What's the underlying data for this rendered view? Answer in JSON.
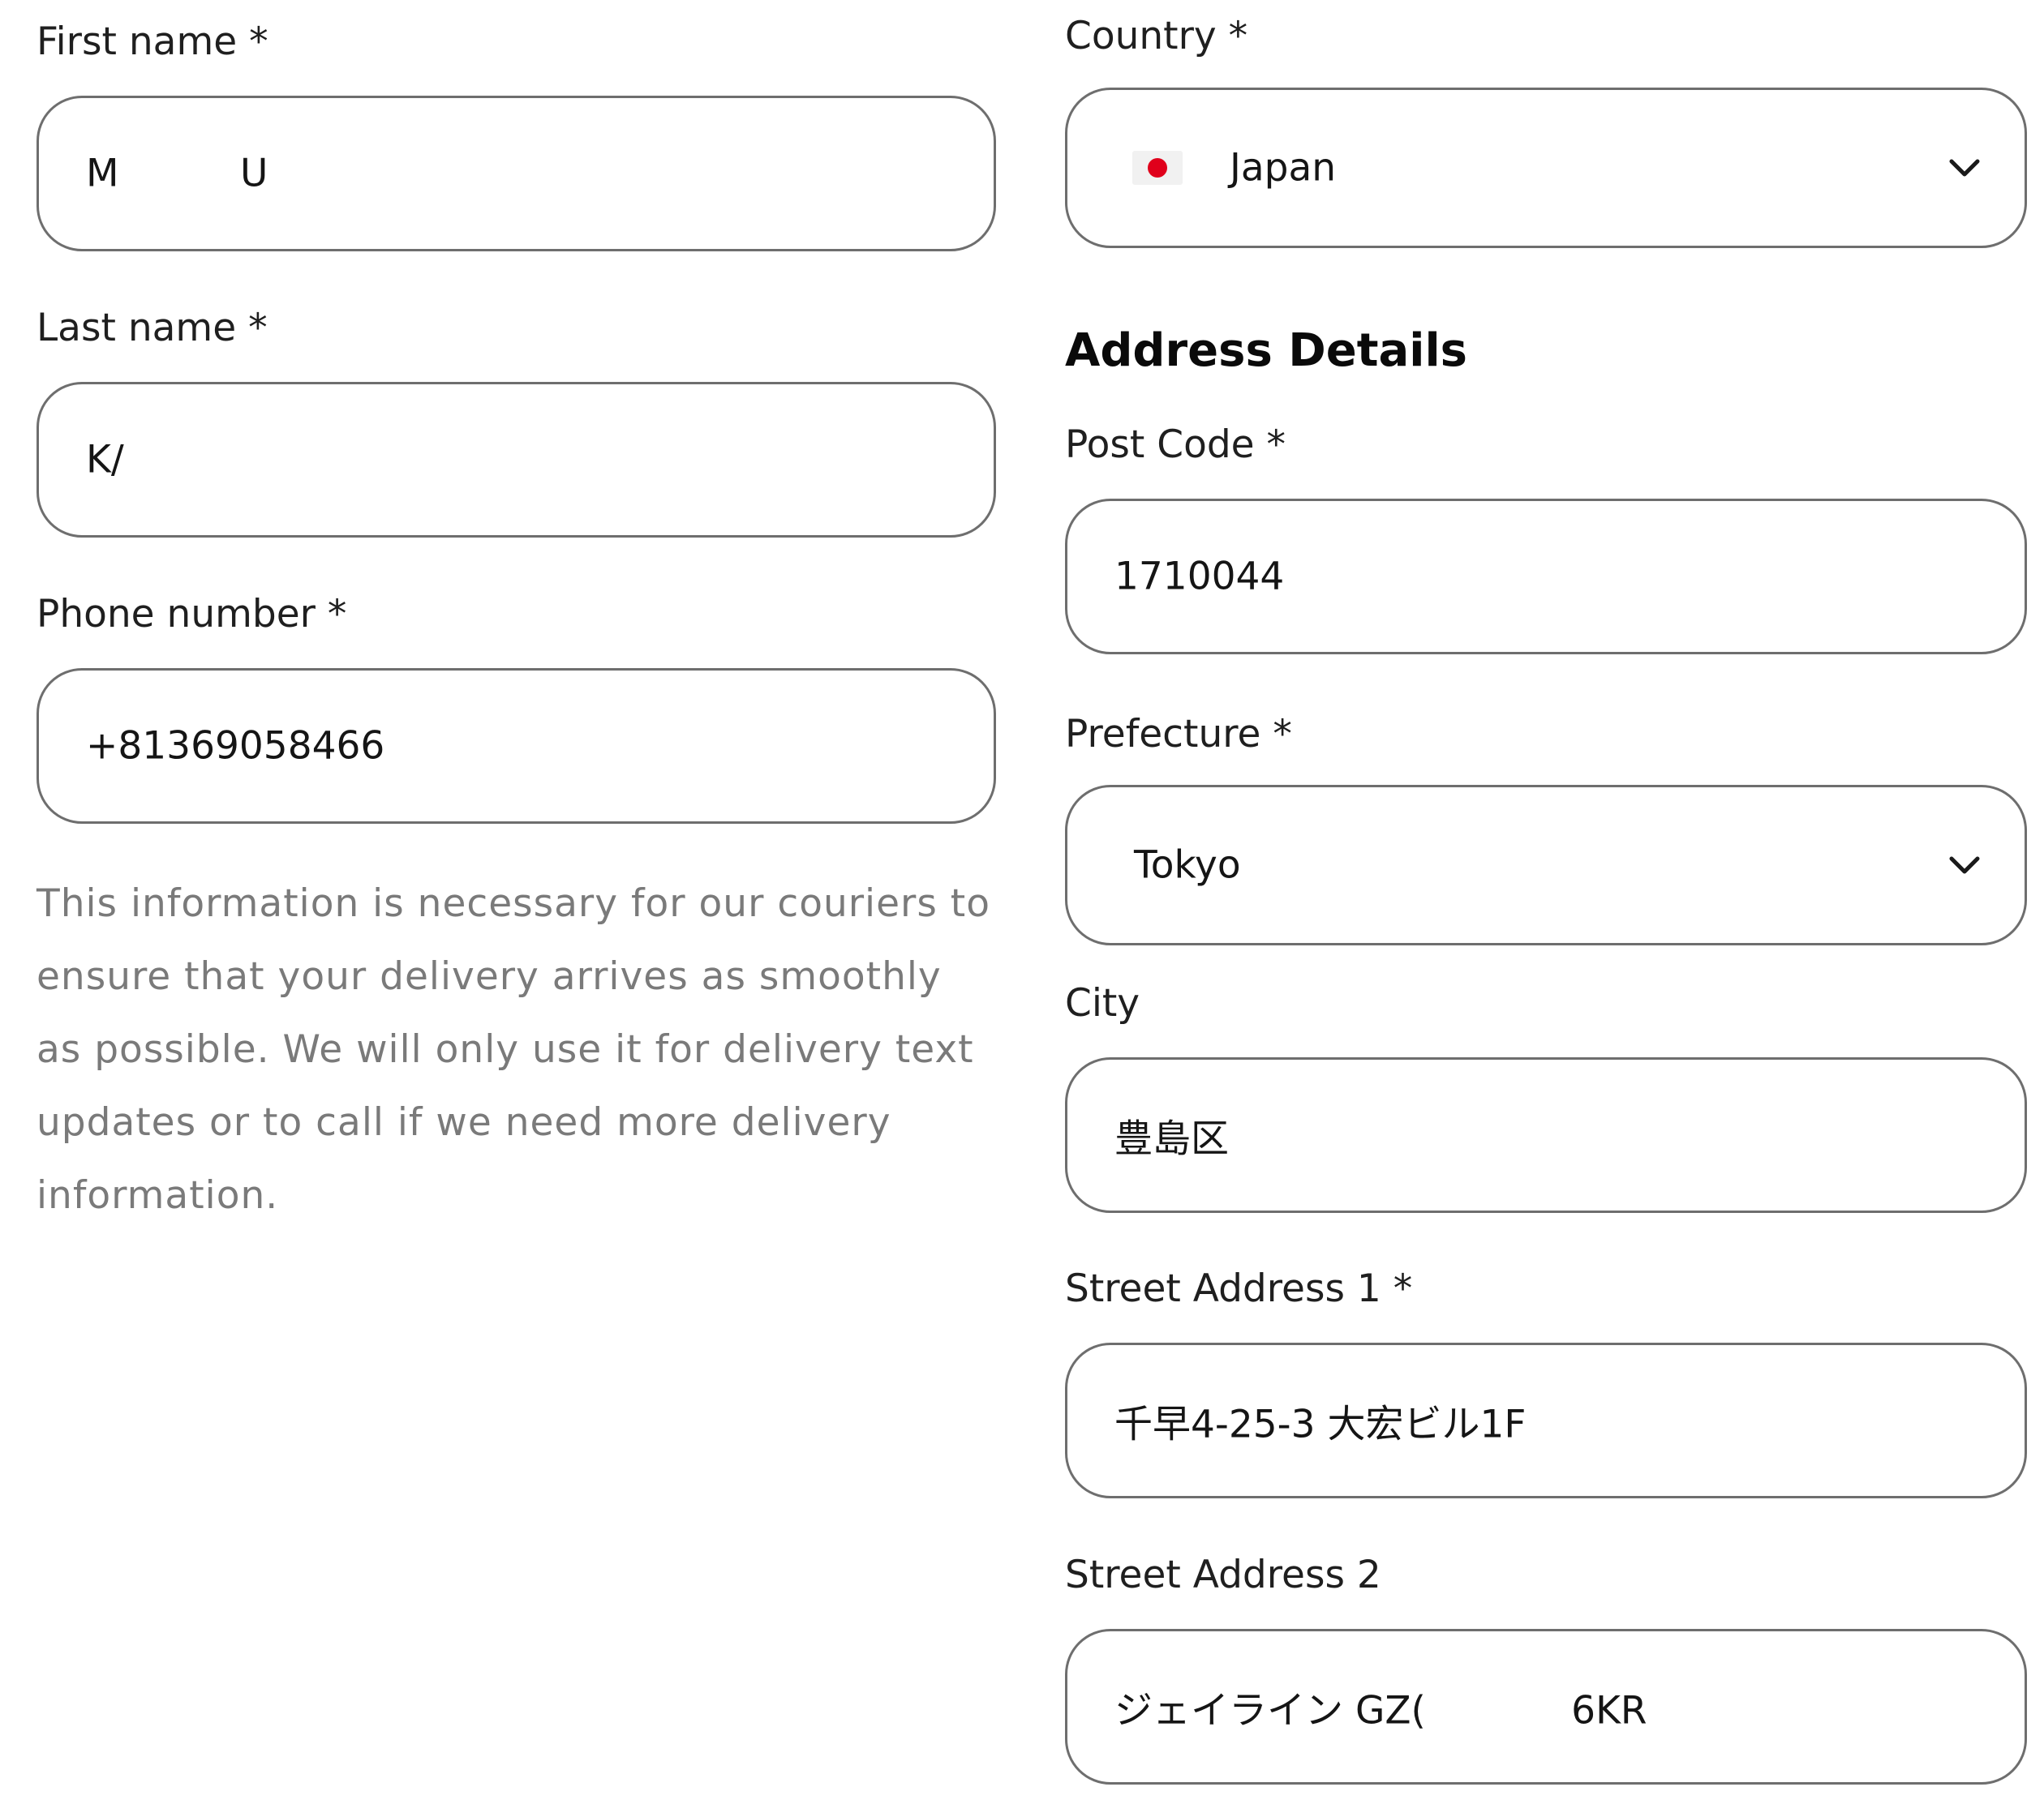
{
  "left": {
    "first_name": {
      "label": "First name *",
      "value": "M          U"
    },
    "last_name": {
      "label": "Last name *",
      "value": "K/"
    },
    "phone": {
      "label": "Phone number *",
      "value": "+81369058466"
    },
    "help_text": "This information is necessary for our couriers to ensure that your delivery arrives as smoothly as possible. We will only use it for delivery text updates or to call if we need more delivery information."
  },
  "right": {
    "country": {
      "label": "Country *",
      "value": "Japan",
      "flag": "japan-flag-icon"
    },
    "section_title": "Address Details",
    "post_code": {
      "label": "Post Code *",
      "value": "1710044"
    },
    "prefecture": {
      "label": "Prefecture *",
      "value": "Tokyo"
    },
    "city": {
      "label": "City",
      "value": "豊島区"
    },
    "street1": {
      "label": "Street Address 1 *",
      "value": "千早4-25-3 大宏ビル1F"
    },
    "street2": {
      "label": "Street Address 2",
      "value": "ジェイライン GZ(            6KR"
    }
  },
  "colors": {
    "border": "#6e6e6e",
    "text": "#1a1a1a",
    "help_text": "#7a7a7a",
    "flag_red": "#e0001b"
  }
}
